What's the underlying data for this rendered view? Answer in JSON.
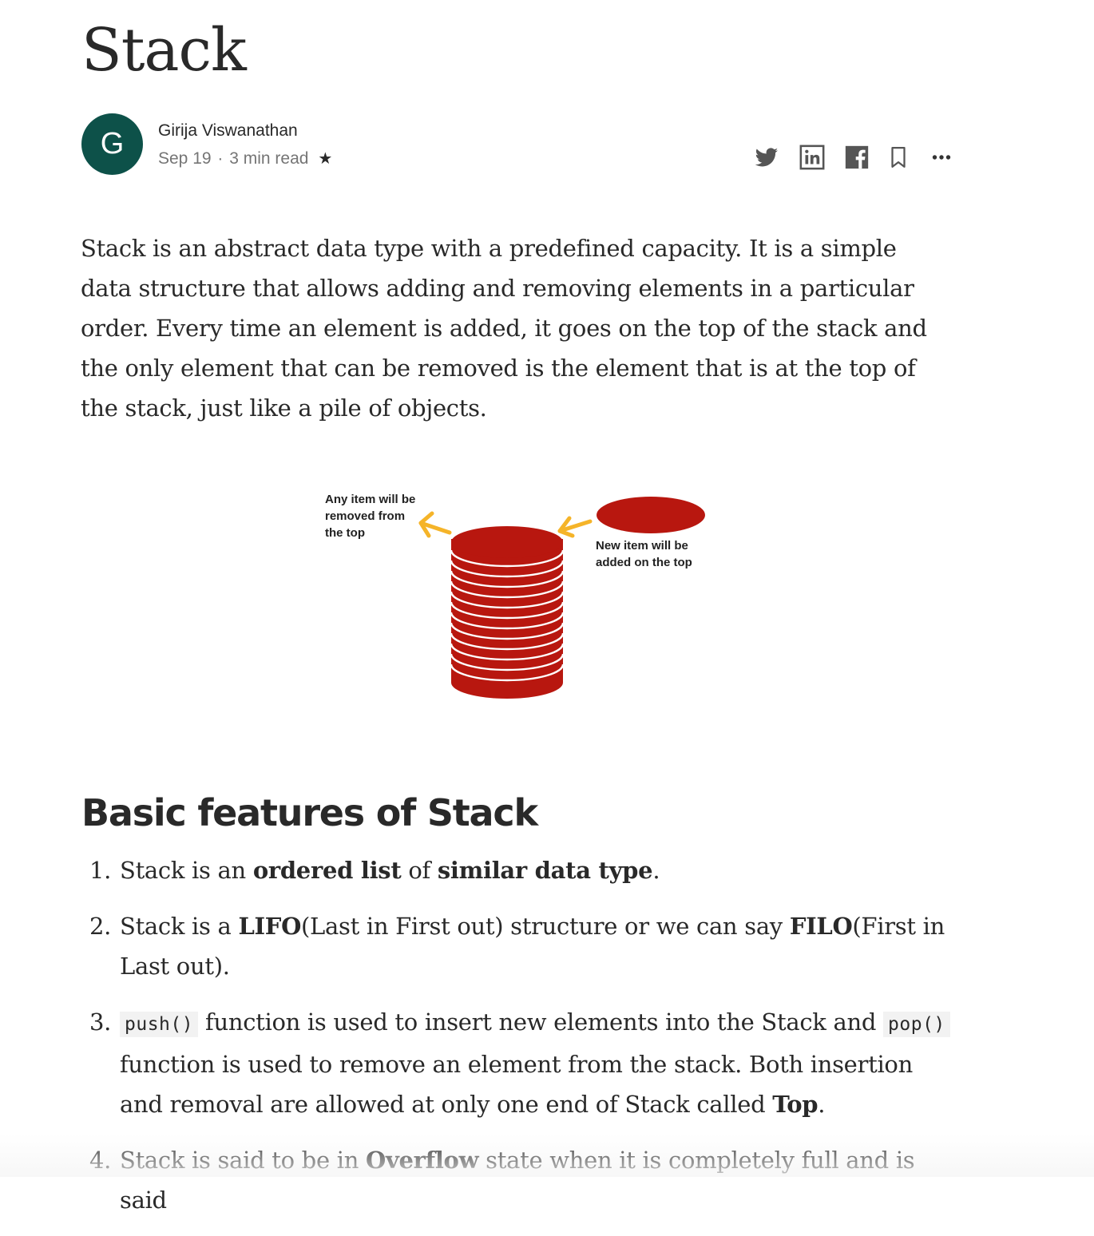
{
  "article": {
    "title": "Stack",
    "author": {
      "initial": "G",
      "name": "Girija Viswanathan",
      "date": "Sep 19",
      "separator": "·",
      "read_time": "3 min read",
      "member_star": "★",
      "avatar_color": "#0d5149"
    },
    "actions": [
      {
        "name": "twitter",
        "icon": "twitter-icon"
      },
      {
        "name": "linkedin",
        "icon": "linkedin-icon"
      },
      {
        "name": "facebook",
        "icon": "facebook-icon"
      },
      {
        "name": "bookmark",
        "icon": "bookmark-icon"
      },
      {
        "name": "more",
        "icon": "more-icon"
      }
    ],
    "intro": "Stack is an abstract data type with a predefined capacity. It is a simple data structure that allows adding and removing elements in a particular order. Every time an element is added, it goes on the top of the stack and the only element that can be removed is the element that is at the top of the stack, just like a pile of objects.",
    "figure": {
      "label_left": [
        "Any item will be",
        "removed from",
        "the top"
      ],
      "label_right": [
        "New item will be",
        "added on the top"
      ],
      "stack_color": "#b8170f",
      "arrow_color": "#f5b429"
    },
    "section_heading": "Basic features of Stack",
    "list": {
      "item1": {
        "num": "1.",
        "a": "Stack is an ",
        "b1": "ordered list",
        "c": " of ",
        "b2": "similar data type",
        "d": "."
      },
      "item2": {
        "num": "2.",
        "a": "Stack is a ",
        "b1": "LIFO",
        "c": "(Last in First out) structure or we can say ",
        "b2": "FILO",
        "d": "(First in Last out)."
      },
      "item3": {
        "num": "3.",
        "code1": "push()",
        "a": " function is used to insert new elements into the Stack and ",
        "code2": "pop()",
        "b": " function is used to remove an element from the stack. Both insertion and removal are allowed at only one end of Stack called ",
        "b1": "Top",
        "c": "."
      },
      "item4": {
        "num": "4.",
        "a": "Stack is said to be in ",
        "b1": "Overflow",
        "c": " state when it is completely full and is said"
      }
    }
  }
}
